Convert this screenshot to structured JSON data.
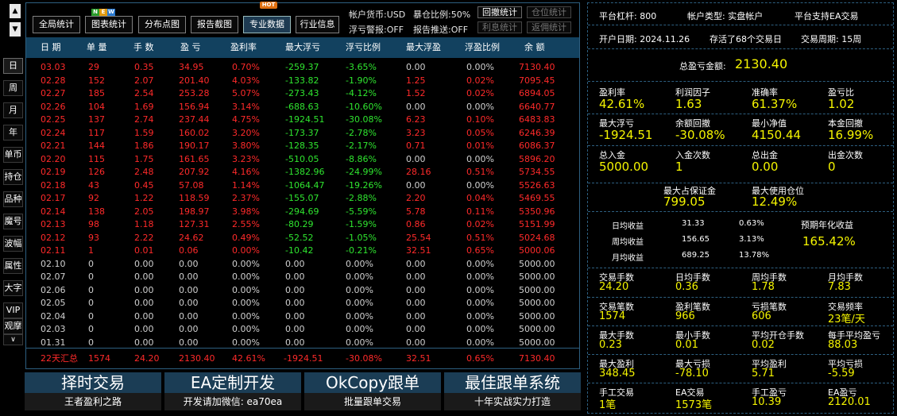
{
  "left_nav": {
    "up": "▲",
    "down": "▼",
    "items": [
      "日",
      "周",
      "月",
      "年",
      "单币",
      "持仓",
      "品种",
      "魔号",
      "波幅",
      "属性",
      "大字",
      "VIP",
      "观摩"
    ],
    "more": "∨"
  },
  "toolbar": {
    "buttons": [
      "全局统计",
      "图表统计",
      "分布点图",
      "报告截图",
      "专业数据",
      "行业信息"
    ],
    "new_badge": [
      "N",
      "E",
      "W"
    ],
    "hot_badge": "HOT",
    "currency": "帐户货币:USD",
    "exposure": "暴仓比例:50%",
    "float_alert": "浮亏警报:OFF",
    "report_push": "报告推送:OFF",
    "stat_buttons": [
      "回撤统计",
      "仓位统计",
      "利息统计",
      "返佣统计"
    ]
  },
  "table": {
    "headers": [
      "日 期",
      "单 量",
      "手 数",
      "盈 亏",
      "盈利率",
      "最大浮亏",
      "浮亏比例",
      "最大浮盈",
      "浮盈比例",
      "余 额"
    ],
    "rows": [
      [
        "03.03",
        "29",
        "0.35",
        "34.95",
        "0.70%",
        "-259.37",
        "-3.65%",
        "0.00",
        "0.00%",
        "7130.40"
      ],
      [
        "02.28",
        "152",
        "2.07",
        "201.40",
        "4.03%",
        "-133.82",
        "-1.90%",
        "1.25",
        "0.02%",
        "7095.45"
      ],
      [
        "02.27",
        "185",
        "2.54",
        "253.28",
        "5.07%",
        "-273.43",
        "-4.12%",
        "1.52",
        "0.02%",
        "6894.05"
      ],
      [
        "02.26",
        "104",
        "1.69",
        "156.94",
        "3.14%",
        "-688.63",
        "-10.60%",
        "0.00",
        "0.00%",
        "6640.77"
      ],
      [
        "02.25",
        "137",
        "2.74",
        "237.44",
        "4.75%",
        "-1924.51",
        "-30.08%",
        "6.23",
        "0.10%",
        "6483.83"
      ],
      [
        "02.24",
        "117",
        "1.59",
        "160.02",
        "3.20%",
        "-173.37",
        "-2.78%",
        "3.23",
        "0.05%",
        "6246.39"
      ],
      [
        "02.21",
        "144",
        "1.86",
        "190.17",
        "3.80%",
        "-128.35",
        "-2.17%",
        "0.71",
        "0.01%",
        "6086.37"
      ],
      [
        "02.20",
        "115",
        "1.75",
        "161.65",
        "3.23%",
        "-510.05",
        "-8.86%",
        "0.00",
        "0.00%",
        "5896.20"
      ],
      [
        "02.19",
        "126",
        "2.48",
        "207.92",
        "4.16%",
        "-1382.96",
        "-24.99%",
        "28.16",
        "0.51%",
        "5734.55"
      ],
      [
        "02.18",
        "43",
        "0.45",
        "57.08",
        "1.14%",
        "-1064.47",
        "-19.26%",
        "0.00",
        "0.00%",
        "5526.63"
      ],
      [
        "02.17",
        "92",
        "1.22",
        "118.59",
        "2.37%",
        "-155.07",
        "-2.88%",
        "2.20",
        "0.04%",
        "5469.55"
      ],
      [
        "02.14",
        "138",
        "2.05",
        "198.97",
        "3.98%",
        "-294.69",
        "-5.59%",
        "5.78",
        "0.11%",
        "5350.96"
      ],
      [
        "02.13",
        "98",
        "1.18",
        "127.31",
        "2.55%",
        "-80.29",
        "-1.59%",
        "0.86",
        "0.02%",
        "5151.99"
      ],
      [
        "02.12",
        "93",
        "2.22",
        "24.62",
        "0.49%",
        "-52.52",
        "-1.05%",
        "25.54",
        "0.51%",
        "5024.68"
      ],
      [
        "02.11",
        "1",
        "0.01",
        "0.06",
        "0.00%",
        "-10.42",
        "-0.21%",
        "32.51",
        "0.65%",
        "5000.06"
      ],
      [
        "02.10",
        "0",
        "0.00",
        "0.00",
        "0.00%",
        "0.00",
        "0.00%",
        "0.00",
        "0.00%",
        "5000.00"
      ],
      [
        "02.07",
        "0",
        "0.00",
        "0.00",
        "0.00%",
        "0.00",
        "0.00%",
        "0.00",
        "0.00%",
        "5000.00"
      ],
      [
        "02.06",
        "0",
        "0.00",
        "0.00",
        "0.00%",
        "0.00",
        "0.00%",
        "0.00",
        "0.00%",
        "5000.00"
      ],
      [
        "02.05",
        "0",
        "0.00",
        "0.00",
        "0.00%",
        "0.00",
        "0.00%",
        "0.00",
        "0.00%",
        "5000.00"
      ],
      [
        "02.04",
        "0",
        "0.00",
        "0.00",
        "0.00%",
        "0.00",
        "0.00%",
        "0.00",
        "0.00%",
        "5000.00"
      ],
      [
        "02.03",
        "0",
        "0.00",
        "0.00",
        "0.00%",
        "0.00",
        "0.00%",
        "0.00",
        "0.00%",
        "5000.00"
      ],
      [
        "01.31",
        "0",
        "0.00",
        "0.00",
        "0.00%",
        "0.00",
        "0.00%",
        "0.00",
        "0.00%",
        "5000.00"
      ]
    ],
    "active_rows": 15,
    "summary": [
      "22天汇总",
      "1574",
      "24.20",
      "2130.40",
      "42.61%",
      "-1924.51",
      "-30.08%",
      "32.51",
      "0.65%",
      "7130.40"
    ]
  },
  "bottom": [
    {
      "title": "择时交易",
      "sub": "王者盈利之路"
    },
    {
      "title": "EA定制开发",
      "sub": "开发请加微信: ea70ea"
    },
    {
      "title": "OkCopy跟单",
      "sub": "批量跟单交易"
    },
    {
      "title": "最佳跟单系统",
      "sub": "十年实战实力打造"
    }
  ],
  "right": {
    "leverage": "平台杠杆: 800",
    "account_type": "帐户类型: 实盘帐户",
    "ea_support": "平台支持EA交易",
    "open_date": "开户日期: 2024.11.26",
    "survived": "存活了68个交易日",
    "period": "交易周期: 15周",
    "total_label": "总盈亏金额:",
    "total_value": "2130.40",
    "grid1": [
      {
        "label": "盈利率",
        "value": "42.61%"
      },
      {
        "label": "利润因子",
        "value": "1.63"
      },
      {
        "label": "准确率",
        "value": "61.37%"
      },
      {
        "label": "盈亏比",
        "value": "1.02"
      },
      {
        "label": "最大浮亏",
        "value": "-1924.51"
      },
      {
        "label": "余额回撤",
        "value": "-30.08%"
      },
      {
        "label": "最小净值",
        "value": "4150.44"
      },
      {
        "label": "本金回撤",
        "value": "16.99%"
      },
      {
        "label": "总入金",
        "value": "5000.00"
      },
      {
        "label": "入金次数",
        "value": "1"
      },
      {
        "label": "总出金",
        "value": "0.00"
      },
      {
        "label": "出金次数",
        "value": "0"
      }
    ],
    "margin": [
      {
        "label": "最大占保证金",
        "value": "799.05"
      },
      {
        "label": "最大使用仓位",
        "value": "12.49%"
      }
    ],
    "avg": [
      {
        "label": "日均收益",
        "value": "31.33",
        "pct": "0.63%"
      },
      {
        "label": "周均收益",
        "value": "156.65",
        "pct": "3.13%"
      },
      {
        "label": "月均收益",
        "value": "689.25",
        "pct": "13.78%"
      }
    ],
    "annual_label": "预期年化收益",
    "annual_value": "165.42%",
    "grid2": [
      {
        "label": "交易手数",
        "value": "24.20"
      },
      {
        "label": "日均手数",
        "value": "0.36"
      },
      {
        "label": "周均手数",
        "value": "1.78"
      },
      {
        "label": "月均手数",
        "value": "7.83"
      },
      {
        "label": "交易笔数",
        "value": "1574"
      },
      {
        "label": "盈利笔数",
        "value": "966"
      },
      {
        "label": "亏损笔数",
        "value": "606"
      },
      {
        "label": "交易频率",
        "value": "23笔/天"
      },
      {
        "label": "最大手数",
        "value": "0.23"
      },
      {
        "label": "最小手数",
        "value": "0.01"
      },
      {
        "label": "平均开仓手数",
        "value": "0.02"
      },
      {
        "label": "每手平均盈亏",
        "value": "88.03"
      },
      {
        "label": "最大盈利",
        "value": "348.45"
      },
      {
        "label": "最大亏损",
        "value": "-78.10"
      },
      {
        "label": "平均盈利",
        "value": "5.71"
      },
      {
        "label": "平均亏损",
        "value": "-5.59"
      },
      {
        "label": "手工交易",
        "value": "1笔"
      },
      {
        "label": "EA交易",
        "value": "1573笔"
      },
      {
        "label": "手工盈亏",
        "value": "10.39"
      },
      {
        "label": "EA盈亏",
        "value": "2120.01"
      }
    ]
  },
  "colors": {
    "red": "#ff2a2a",
    "green": "#2fe52f",
    "yellow": "#f4f400",
    "header": "#12415f",
    "border": "#2d5f80"
  }
}
